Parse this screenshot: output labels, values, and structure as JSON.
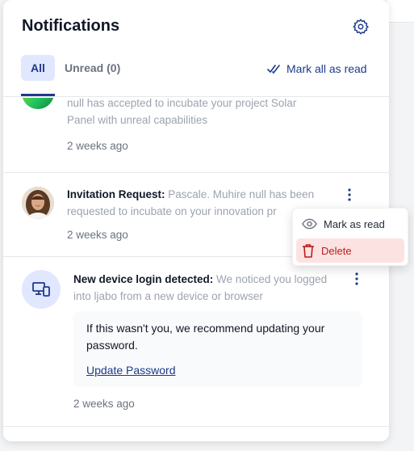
{
  "header": {
    "title": "Notifications",
    "settings_icon": "gear-icon"
  },
  "tabs": {
    "all_label": "All",
    "unread_label": "Unread (0)",
    "mark_all_label": "Mark all as read"
  },
  "notifications": [
    {
      "line1": "null has accepted to incubate your project Solar",
      "line2": "Panel with unreal capabilities",
      "time": "2 weeks ago"
    },
    {
      "title": "Invitation Request:",
      "line1_rest": " Pascale. Muhire null has been",
      "line2": "requested to incubate on your innovation pr",
      "time": "2 weeks ago"
    },
    {
      "title": "New device login detected:",
      "line1_rest": " We noticed you logged",
      "line2": "into ljabo from a new device or browser",
      "warning": "If this wasn't you, we recommend updating your password.",
      "link": "Update Password",
      "time": "2 weeks ago"
    }
  ],
  "context_menu": {
    "mark_read": "Mark as read",
    "delete": "Delete"
  },
  "colors": {
    "accent": "#1e3a8a",
    "danger": "#b91c1c",
    "danger_bg": "#fde2e2",
    "tab_bg": "#e0e7ff"
  }
}
